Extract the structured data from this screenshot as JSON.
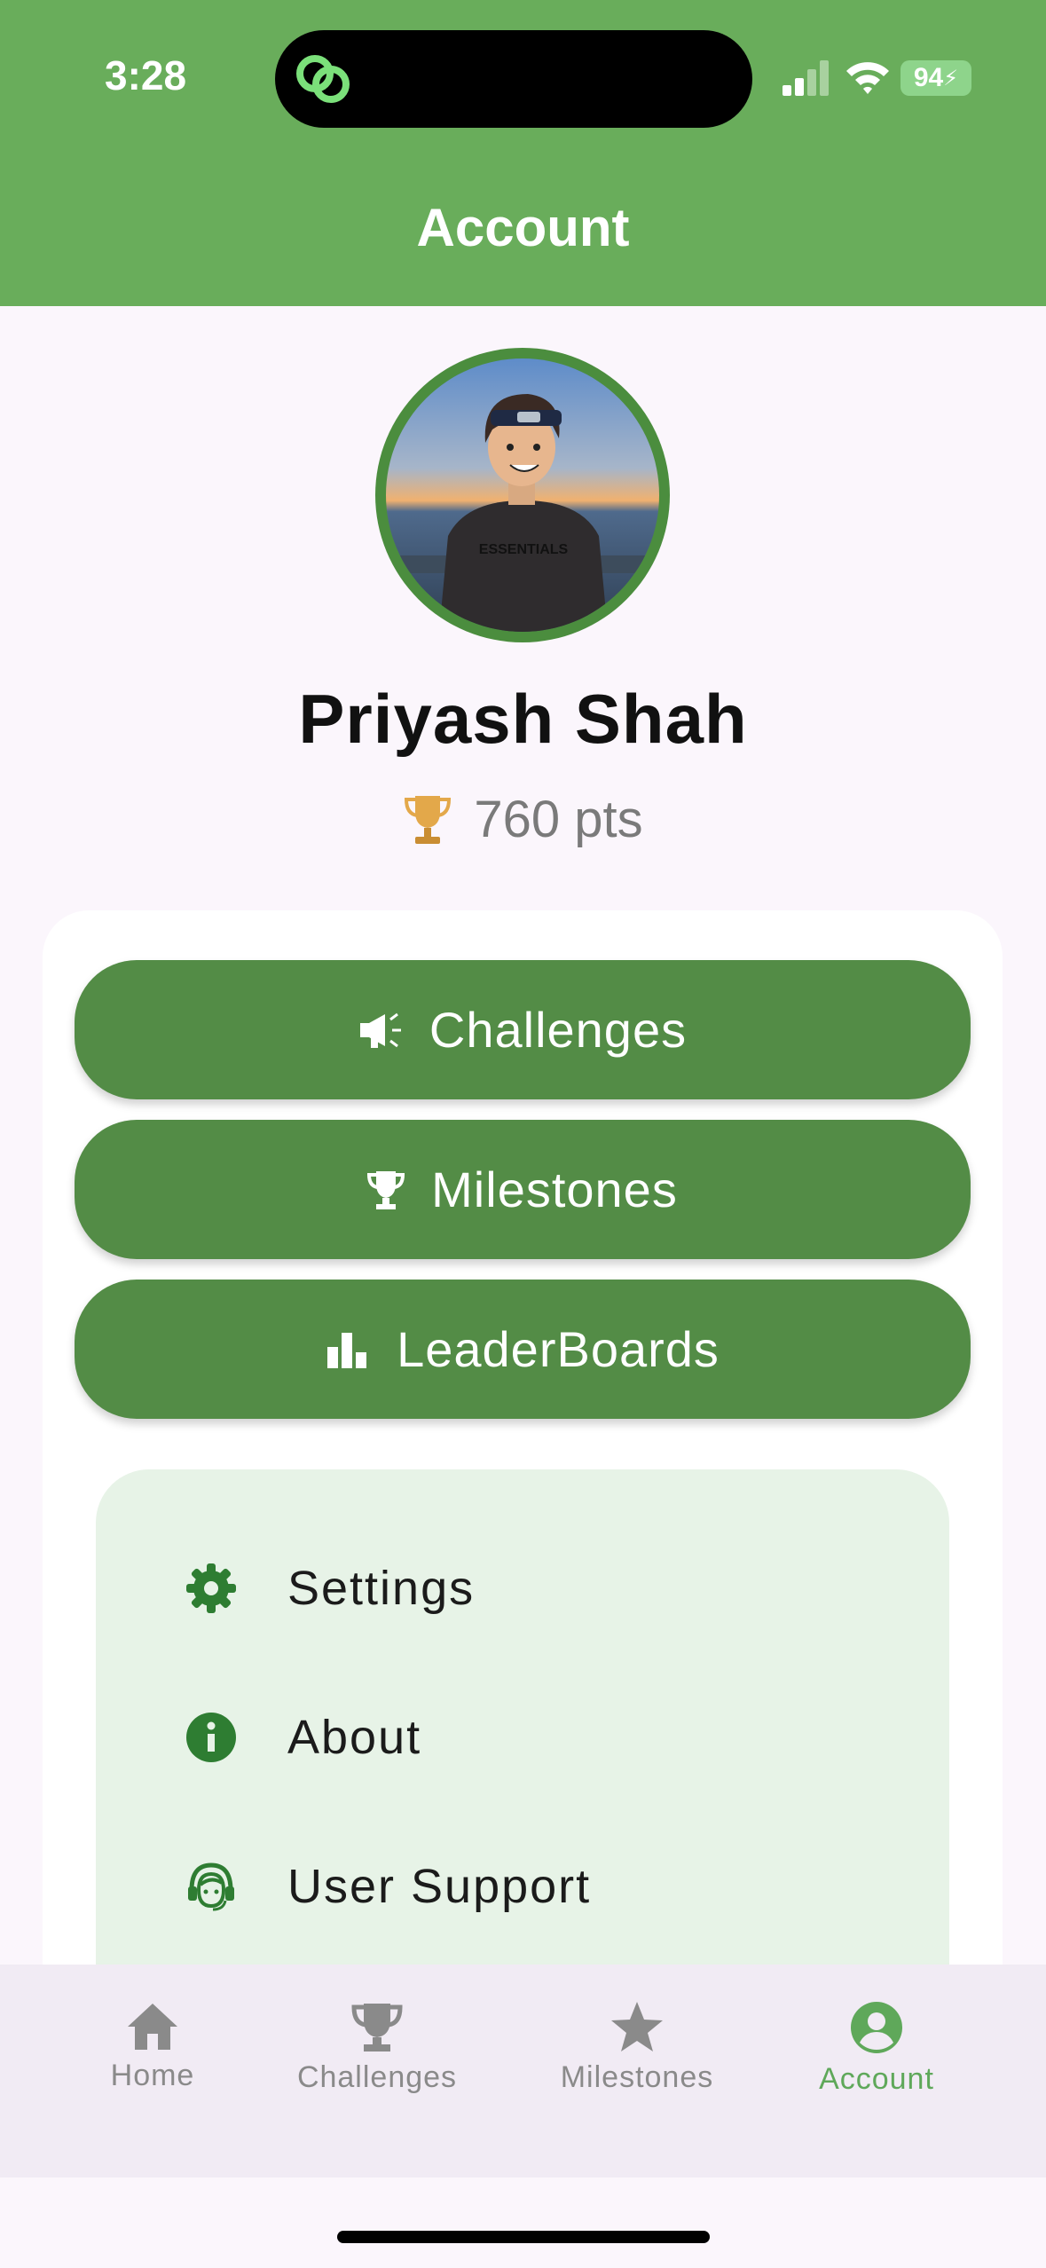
{
  "status_bar": {
    "time": "3:28",
    "battery": "94"
  },
  "header": {
    "title": "Account"
  },
  "profile": {
    "name": "Priyash Shah",
    "points": "760 pts",
    "avatar_shirt_text": "ESSENTIALS"
  },
  "actions": [
    {
      "label": "Challenges",
      "icon": "megaphone-icon"
    },
    {
      "label": "Milestones",
      "icon": "trophy-icon"
    },
    {
      "label": "LeaderBoards",
      "icon": "bar-chart-icon"
    }
  ],
  "menu": [
    {
      "label": "Settings",
      "icon": "gear-icon"
    },
    {
      "label": "About",
      "icon": "info-icon"
    },
    {
      "label": "User Support",
      "icon": "support-agent-icon"
    }
  ],
  "bottom_nav": [
    {
      "label": "Home",
      "icon": "home-icon",
      "active": false
    },
    {
      "label": "Challenges",
      "icon": "trophy-icon",
      "active": false
    },
    {
      "label": "Milestones",
      "icon": "star-icon",
      "active": false
    },
    {
      "label": "Account",
      "icon": "account-circle-icon",
      "active": true
    }
  ],
  "colors": {
    "header": "#69ad5b",
    "button": "#538c46",
    "menu_panel": "#e7f3e7",
    "nav_active": "#5fa85a",
    "nav_inactive": "#8a8a8a"
  }
}
